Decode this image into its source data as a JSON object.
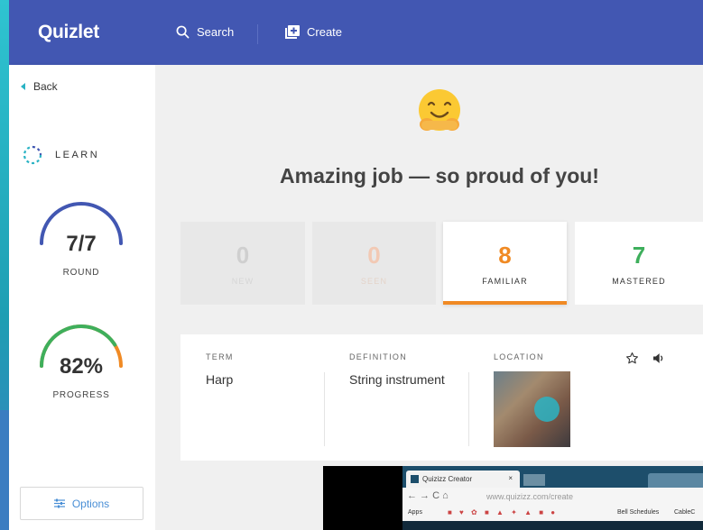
{
  "header": {
    "logo": "Quizlet",
    "search_label": "Search",
    "create_label": "Create"
  },
  "sidebar": {
    "back_label": "Back",
    "mode_label": "LEARN",
    "round": {
      "value": "7/7",
      "label": "ROUND",
      "fraction": 1.0
    },
    "progress": {
      "value": "82%",
      "label": "PROGRESS",
      "fraction": 0.82
    },
    "options_label": "Options"
  },
  "main": {
    "headline": "Amazing job — so proud of you!",
    "stats": {
      "new": {
        "value": "0",
        "label": "NEW"
      },
      "seen": {
        "value": "0",
        "label": "SEEN"
      },
      "familiar": {
        "value": "8",
        "label": "FAMILIAR"
      },
      "mastered": {
        "value": "7",
        "label": "MASTERED"
      }
    },
    "card": {
      "term_header": "TERM",
      "definition_header": "DEFINITION",
      "location_header": "LOCATION",
      "term": "Harp",
      "definition": "String instrument"
    }
  },
  "browser": {
    "tab_title": "Quizizz Creator",
    "tab_close": "×",
    "url_host": "www.quizizz.com",
    "url_path": "/create",
    "bookmarks": {
      "apps": "Apps",
      "bell": "Bell Schedules",
      "cable": "CableC"
    }
  },
  "colors": {
    "header_bg": "#4257b2",
    "familiar": "#f08a24",
    "mastered": "#3eaf5c",
    "round_arc": "#4257b2",
    "accent_teal": "#2ab3c4"
  }
}
